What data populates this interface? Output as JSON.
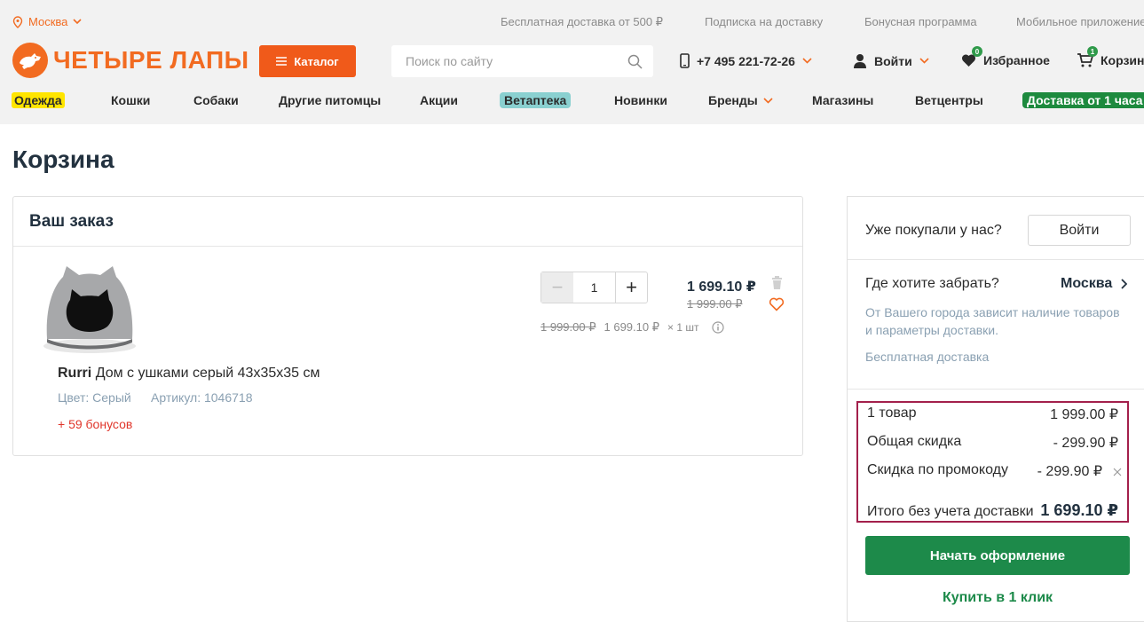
{
  "colors": {
    "accent": "#f26b21",
    "green": "#1d8a4a",
    "highlight_border": "#a3204b"
  },
  "topbar": {
    "city": "Москва",
    "links": [
      "Бесплатная доставка от 500 ₽",
      "Подписка на доставку",
      "Бонусная программа",
      "Мобильное приложение"
    ]
  },
  "header": {
    "logo_text": "ЧЕТЫРЕ ЛАПЫ",
    "catalog_label": "Каталог",
    "search_placeholder": "Поиск по сайту",
    "phone": "+7 495 221-72-26",
    "login_label": "Войти",
    "favorites_label": "Избранное",
    "favorites_count": "0",
    "cart_label": "Корзина",
    "cart_count": "1"
  },
  "nav": {
    "items": [
      "Одежда",
      "Кошки",
      "Собаки",
      "Другие питомцы",
      "Акции",
      "Ветаптека",
      "Новинки",
      "Бренды",
      "Магазины",
      "Ветцентры",
      "Доставка от 1 часа"
    ]
  },
  "page": {
    "title": "Корзина"
  },
  "order": {
    "title": "Ваш заказ",
    "item": {
      "brand": "Rurri",
      "name": "Дом с ушками серый 43х35х35 см",
      "color_label": "Цвет: Серый",
      "sku_label": "Артикул: 1046718",
      "bonus": "+ 59 бонусов",
      "quantity": "1",
      "price": "1 699.10 ₽",
      "old_price": "1 999.00 ₽",
      "unit_old_price": "1 999.00 ₽",
      "unit_price": "1 699.10 ₽",
      "unit_qty": "× 1 шт"
    }
  },
  "sidebar": {
    "returning_text": "Уже покупали у нас?",
    "login_button": "Войти",
    "pickup_question": "Где хотите забрать?",
    "pickup_city": "Москва",
    "city_note": "От Вашего города зависит наличие товаров и параметры доставки.",
    "free_delivery": "Бесплатная доставка",
    "summary": {
      "items_label": "1 товар",
      "items_value": "1 999.00 ₽",
      "discount_label": "Общая скидка",
      "discount_value": "- 299.90 ₽",
      "promo_label": "Скидка по промокоду",
      "promo_value": "- 299.90 ₽",
      "total_label": "Итого без учета доставки",
      "total_value": "1 699.10 ₽"
    },
    "checkout_button": "Начать оформление",
    "one_click": "Купить в 1 клик"
  }
}
